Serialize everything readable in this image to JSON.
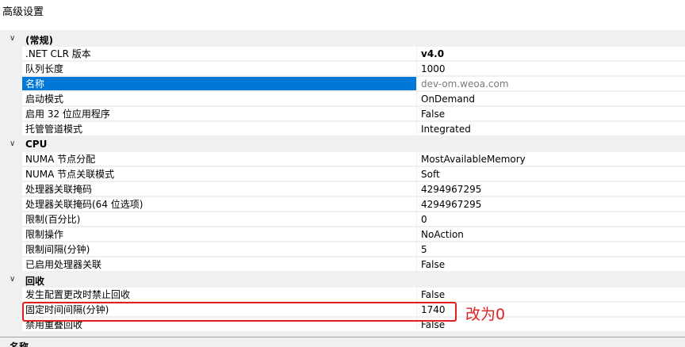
{
  "window": {
    "title": "高级设置"
  },
  "grid": {
    "categories": [
      {
        "label": "(常规)",
        "items": [
          {
            "name": ".NET CLR 版本",
            "value": "v4.0"
          },
          {
            "name": "队列长度",
            "value": "1000"
          },
          {
            "name": "名称",
            "value": "dev-om.weoa.com"
          },
          {
            "name": "启动模式",
            "value": "OnDemand"
          },
          {
            "name": "启用 32 位应用程序",
            "value": "False"
          },
          {
            "name": "托管管道模式",
            "value": "Integrated"
          }
        ]
      },
      {
        "label": "CPU",
        "items": [
          {
            "name": "NUMA 节点分配",
            "value": "MostAvailableMemory"
          },
          {
            "name": "NUMA 节点关联模式",
            "value": "Soft"
          },
          {
            "name": "处理器关联掩码",
            "value": "4294967295"
          },
          {
            "name": "处理器关联掩码(64 位选项)",
            "value": "4294967295"
          },
          {
            "name": "限制(百分比)",
            "value": "0"
          },
          {
            "name": "限制操作",
            "value": "NoAction"
          },
          {
            "name": "限制间隔(分钟)",
            "value": "5"
          },
          {
            "name": "已启用处理器关联",
            "value": "False"
          }
        ]
      },
      {
        "label": "回收",
        "items": [
          {
            "name": "发生配置更改时禁止回收",
            "value": "False"
          },
          {
            "name": "固定时间间隔(分钟)",
            "value": "1740"
          },
          {
            "name": "禁用重叠回收",
            "value": "False"
          }
        ]
      }
    ]
  },
  "annotation": {
    "text": "改为0",
    "color": "#e02020"
  },
  "description": {
    "title": "名称"
  },
  "colors": {
    "selection": "#0078d7",
    "background": "#f0f0f0",
    "annotation": "#e02020"
  }
}
